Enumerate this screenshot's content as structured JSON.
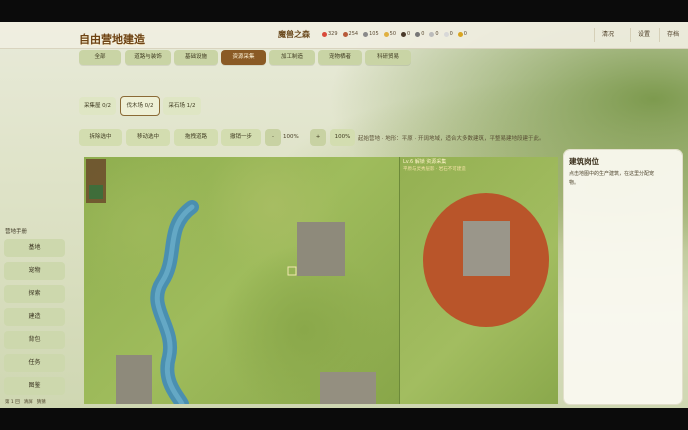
{
  "header": {
    "title": "魔兽之森",
    "resources": [
      {
        "icon": "apple-icon",
        "value": "329",
        "color": "#d94a3a"
      },
      {
        "icon": "meat-icon",
        "value": "254",
        "color": "#b85a3a"
      },
      {
        "icon": "moon-icon",
        "value": "105",
        "color": "#8a8a8a"
      },
      {
        "icon": "coin-icon",
        "value": "50",
        "color": "#e0b040"
      },
      {
        "icon": "ore-icon",
        "value": "0",
        "color": "#4a3a2a"
      },
      {
        "icon": "stone-icon",
        "value": "0",
        "color": "#777777"
      },
      {
        "icon": "gem-icon",
        "value": "0",
        "color": "#bbbbbb"
      },
      {
        "icon": "crystal-icon",
        "value": "0",
        "color": "#d8d8d8"
      },
      {
        "icon": "gold-icon",
        "value": "0",
        "color": "#d9a520"
      }
    ],
    "buttons": [
      "清况",
      "设置",
      "存档"
    ]
  },
  "page": {
    "title": "自由营地建造"
  },
  "tabs": [
    "全部",
    "道路与装饰",
    "基础设施",
    "资源采集",
    "加工制造",
    "宠物栖者",
    "科研贸易"
  ],
  "active_tab": "资源采集",
  "subtabs": [
    "采集屋 0/2",
    "伐木场 0/2",
    "采石场 1/2"
  ],
  "active_subtab": "伐木场 0/2",
  "toolbar": {
    "buttons": [
      "拆除选中",
      "移动选中",
      "拖拽道路",
      "撤销一步",
      "-",
      "+",
      "100%"
    ],
    "zoom": "100%",
    "hint": "起始营地 · 地形：平原 · 开阔地域，适合大多数建筑，平整易建地段建于此。"
  },
  "map_preview": {
    "header": "Lv.6 解锁 资源采集",
    "sub": "平原与灵秀层影 · 岩石不可建造"
  },
  "sidebar": {
    "title": "营地手册",
    "items": [
      "基地",
      "宠物",
      "探索",
      "建造",
      "背包",
      "任务",
      "图鉴"
    ]
  },
  "footer": {
    "status": [
      "第 1 回",
      "清屏",
      "猜猜"
    ]
  },
  "info_panel": {
    "title": "建筑岗位",
    "desc": "点击地图中的生产建筑，在这里分配宠物。"
  },
  "colors": {
    "accent": "#8a5a25",
    "tab_bg": "#c9d4a5",
    "panel_bg": "#faf9f0",
    "dirt": "#b9552a",
    "river": "#4a8fb0"
  }
}
